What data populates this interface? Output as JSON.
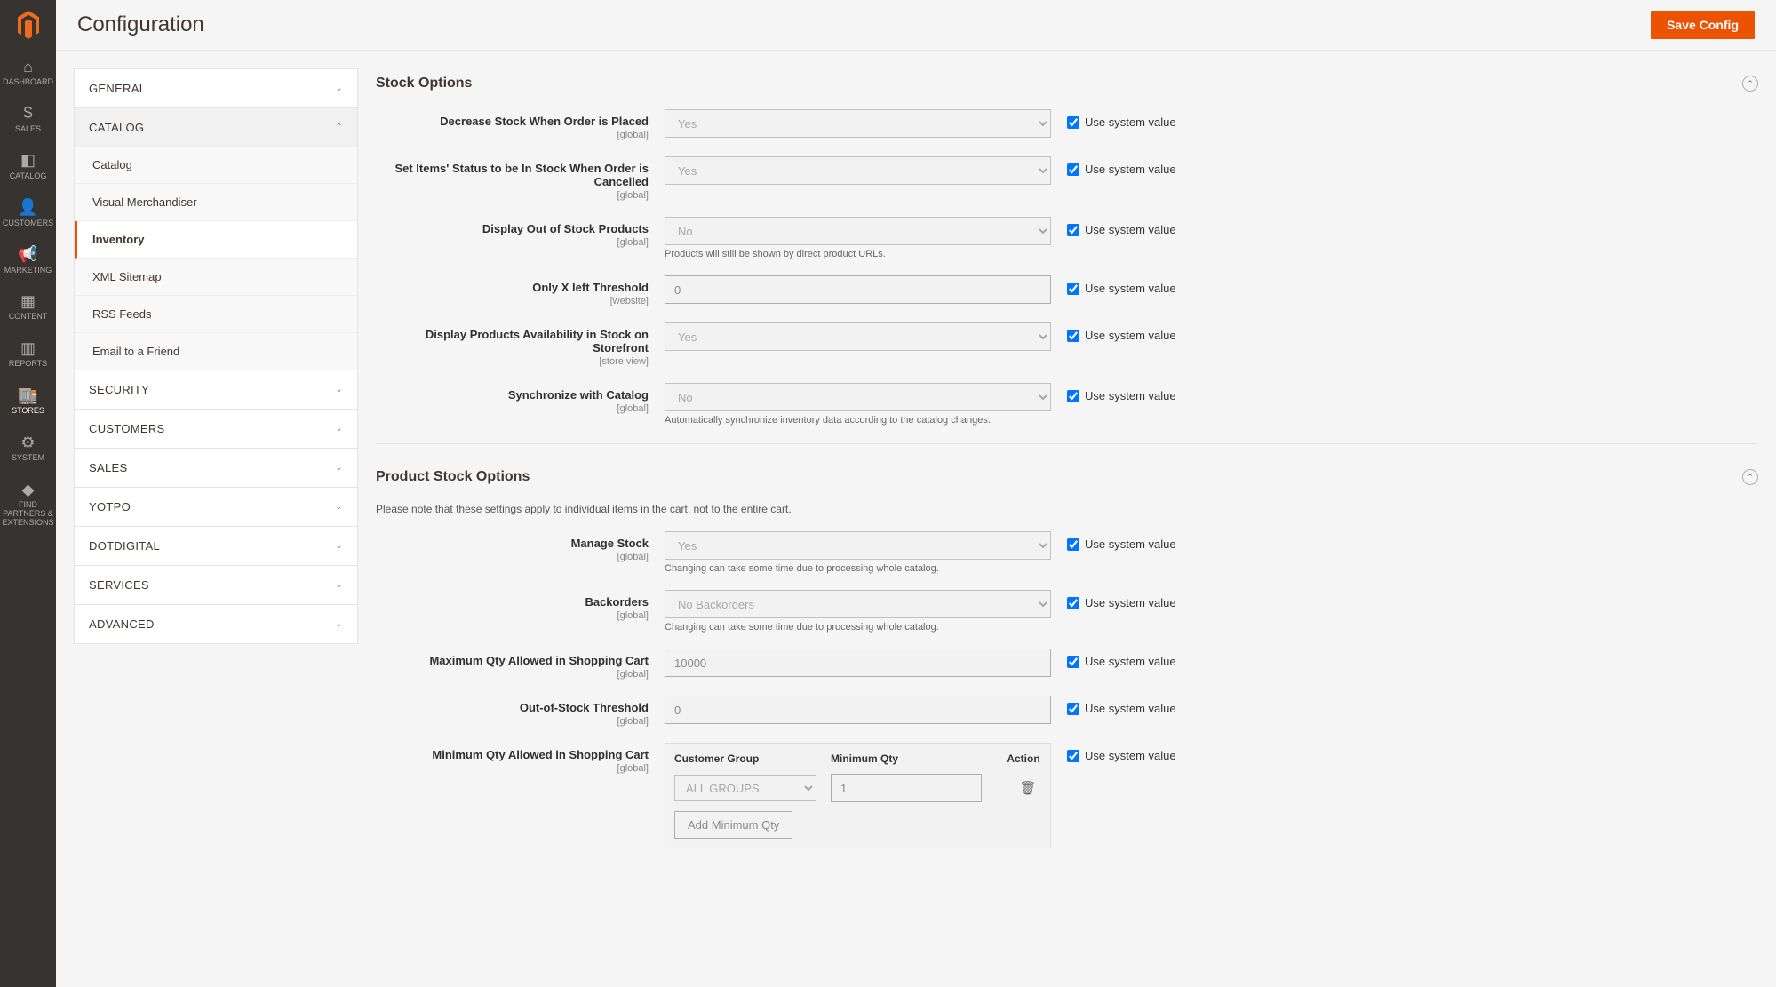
{
  "header": {
    "page_title": "Configuration",
    "save_label": "Save Config"
  },
  "nav": [
    {
      "key": "dashboard",
      "label": "DASHBOARD",
      "icon": "⌂"
    },
    {
      "key": "sales",
      "label": "SALES",
      "icon": "$"
    },
    {
      "key": "catalog",
      "label": "CATALOG",
      "icon": "◧"
    },
    {
      "key": "customers",
      "label": "CUSTOMERS",
      "icon": "👤"
    },
    {
      "key": "marketing",
      "label": "MARKETING",
      "icon": "📢"
    },
    {
      "key": "content",
      "label": "CONTENT",
      "icon": "▦"
    },
    {
      "key": "reports",
      "label": "REPORTS",
      "icon": "▥"
    },
    {
      "key": "stores",
      "label": "STORES",
      "icon": "🏬"
    },
    {
      "key": "system",
      "label": "SYSTEM",
      "icon": "⚙"
    },
    {
      "key": "partners",
      "label": "FIND PARTNERS & EXTENSIONS",
      "icon": "◆"
    }
  ],
  "active_nav": "stores",
  "sidebar": {
    "sections": [
      {
        "label": "GENERAL",
        "expanded": false
      },
      {
        "label": "CATALOG",
        "expanded": true,
        "items": [
          {
            "label": "Catalog"
          },
          {
            "label": "Visual Merchandiser"
          },
          {
            "label": "Inventory",
            "active": true
          },
          {
            "label": "XML Sitemap"
          },
          {
            "label": "RSS Feeds"
          },
          {
            "label": "Email to a Friend"
          }
        ]
      },
      {
        "label": "SECURITY",
        "expanded": false
      },
      {
        "label": "CUSTOMERS",
        "expanded": false
      },
      {
        "label": "SALES",
        "expanded": false
      },
      {
        "label": "YOTPO",
        "expanded": false
      },
      {
        "label": "DOTDIGITAL",
        "expanded": false
      },
      {
        "label": "SERVICES",
        "expanded": false
      },
      {
        "label": "ADVANCED",
        "expanded": false
      }
    ]
  },
  "use_system_label": "Use system value",
  "stock_options": {
    "title": "Stock Options",
    "fields": [
      {
        "label": "Decrease Stock When Order is Placed",
        "scope": "[global]",
        "value": "Yes",
        "type": "select",
        "sys": true
      },
      {
        "label": "Set Items' Status to be In Stock When Order is Cancelled",
        "scope": "[global]",
        "value": "Yes",
        "type": "select",
        "sys": true
      },
      {
        "label": "Display Out of Stock Products",
        "scope": "[global]",
        "value": "No",
        "type": "select",
        "sys": true,
        "hint": "Products will still be shown by direct product URLs."
      },
      {
        "label": "Only X left Threshold",
        "scope": "[website]",
        "value": "0",
        "type": "text",
        "sys": true
      },
      {
        "label": "Display Products Availability in Stock on Storefront",
        "scope": "[store view]",
        "value": "Yes",
        "type": "select",
        "sys": true
      },
      {
        "label": "Synchronize with Catalog",
        "scope": "[global]",
        "value": "No",
        "type": "select",
        "sys": true,
        "hint": "Automatically synchronize inventory data according to the catalog changes."
      }
    ]
  },
  "product_stock": {
    "title": "Product Stock Options",
    "note": "Please note that these settings apply to individual items in the cart, not to the entire cart.",
    "fields": [
      {
        "label": "Manage Stock",
        "scope": "[global]",
        "value": "Yes",
        "type": "select",
        "sys": true,
        "hint": "Changing can take some time due to processing whole catalog."
      },
      {
        "label": "Backorders",
        "scope": "[global]",
        "value": "No Backorders",
        "type": "select",
        "sys": true,
        "hint": "Changing can take some time due to processing whole catalog."
      },
      {
        "label": "Maximum Qty Allowed in Shopping Cart",
        "scope": "[global]",
        "value": "10000",
        "type": "text",
        "sys": true
      },
      {
        "label": "Out-of-Stock Threshold",
        "scope": "[global]",
        "value": "0",
        "type": "text",
        "sys": true
      }
    ],
    "min_qty": {
      "label": "Minimum Qty Allowed in Shopping Cart",
      "scope": "[global]",
      "sys": true,
      "columns": {
        "group": "Customer Group",
        "qty": "Minimum Qty",
        "action": "Action"
      },
      "rows": [
        {
          "group": "ALL GROUPS",
          "qty": "1"
        }
      ],
      "add_label": "Add Minimum Qty"
    }
  }
}
